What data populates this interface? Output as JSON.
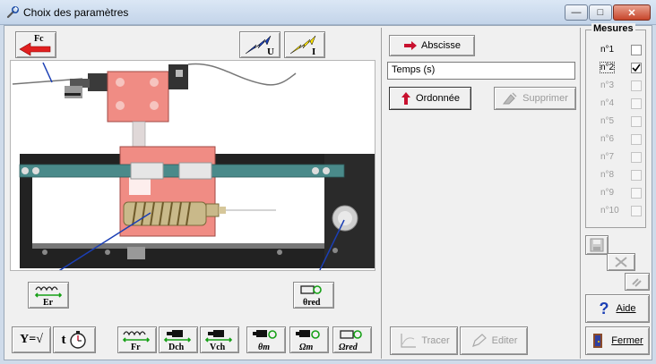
{
  "window": {
    "title": "Choix des paramètres",
    "controls": {
      "minimize": "—",
      "maximize": "□",
      "close": "✕"
    }
  },
  "schematic": {
    "top_buttons": [
      {
        "label": "Fc",
        "icon": "left-red-arrow-icon"
      },
      {
        "label": "U",
        "icon": "blue-lightning-arrow-icon"
      },
      {
        "label": "I",
        "icon": "yellow-lightning-arrow-icon"
      }
    ],
    "left_label": "Er",
    "right_label": "θred"
  },
  "bottom_buttons": [
    {
      "label": "Y=√",
      "icon": ""
    },
    {
      "label": "t",
      "icon": "stopwatch-icon"
    },
    {
      "label": "Fr",
      "icon": "spring-icon"
    },
    {
      "label": "Dch",
      "icon": "motor-icon"
    },
    {
      "label": "Vch",
      "icon": "motor-icon"
    },
    {
      "label": "θm",
      "icon": "motor-rotation-icon"
    },
    {
      "label": "Ωm",
      "icon": "motor-rotation-icon"
    },
    {
      "label": "Ωred",
      "icon": "reducer-rotation-icon"
    }
  ],
  "params": {
    "abscisse_label": "Abscisse",
    "abscisse_value": "Temps (s)",
    "ordonnee_label": "Ordonnée",
    "supprimer_label": "Supprimer",
    "tracer_label": "Tracer",
    "editer_label": "Editer"
  },
  "mesures": {
    "legend": "Mesures",
    "items": [
      {
        "label": "n°1",
        "checked": false,
        "enabled": true,
        "focused": false
      },
      {
        "label": "n°2",
        "checked": true,
        "enabled": true,
        "focused": true
      },
      {
        "label": "n°3",
        "checked": false,
        "enabled": false,
        "focused": false
      },
      {
        "label": "n°4",
        "checked": false,
        "enabled": false,
        "focused": false
      },
      {
        "label": "n°5",
        "checked": false,
        "enabled": false,
        "focused": false
      },
      {
        "label": "n°6",
        "checked": false,
        "enabled": false,
        "focused": false
      },
      {
        "label": "n°7",
        "checked": false,
        "enabled": false,
        "focused": false
      },
      {
        "label": "n°8",
        "checked": false,
        "enabled": false,
        "focused": false
      },
      {
        "label": "n°9",
        "checked": false,
        "enabled": false,
        "focused": false
      },
      {
        "label": "n°10",
        "checked": false,
        "enabled": false,
        "focused": false
      }
    ]
  },
  "side_actions": {
    "aide_label": "Aide",
    "fermer_label": "Fermer"
  },
  "colors": {
    "title_bg": "#c9d9ee",
    "client_bg": "#f0f0f0",
    "salmon": "#f08c84",
    "axle": "#4a8a8a",
    "frame": "#222222",
    "accent_red": "#c8102e",
    "accent_blue": "#1b3fb5"
  }
}
